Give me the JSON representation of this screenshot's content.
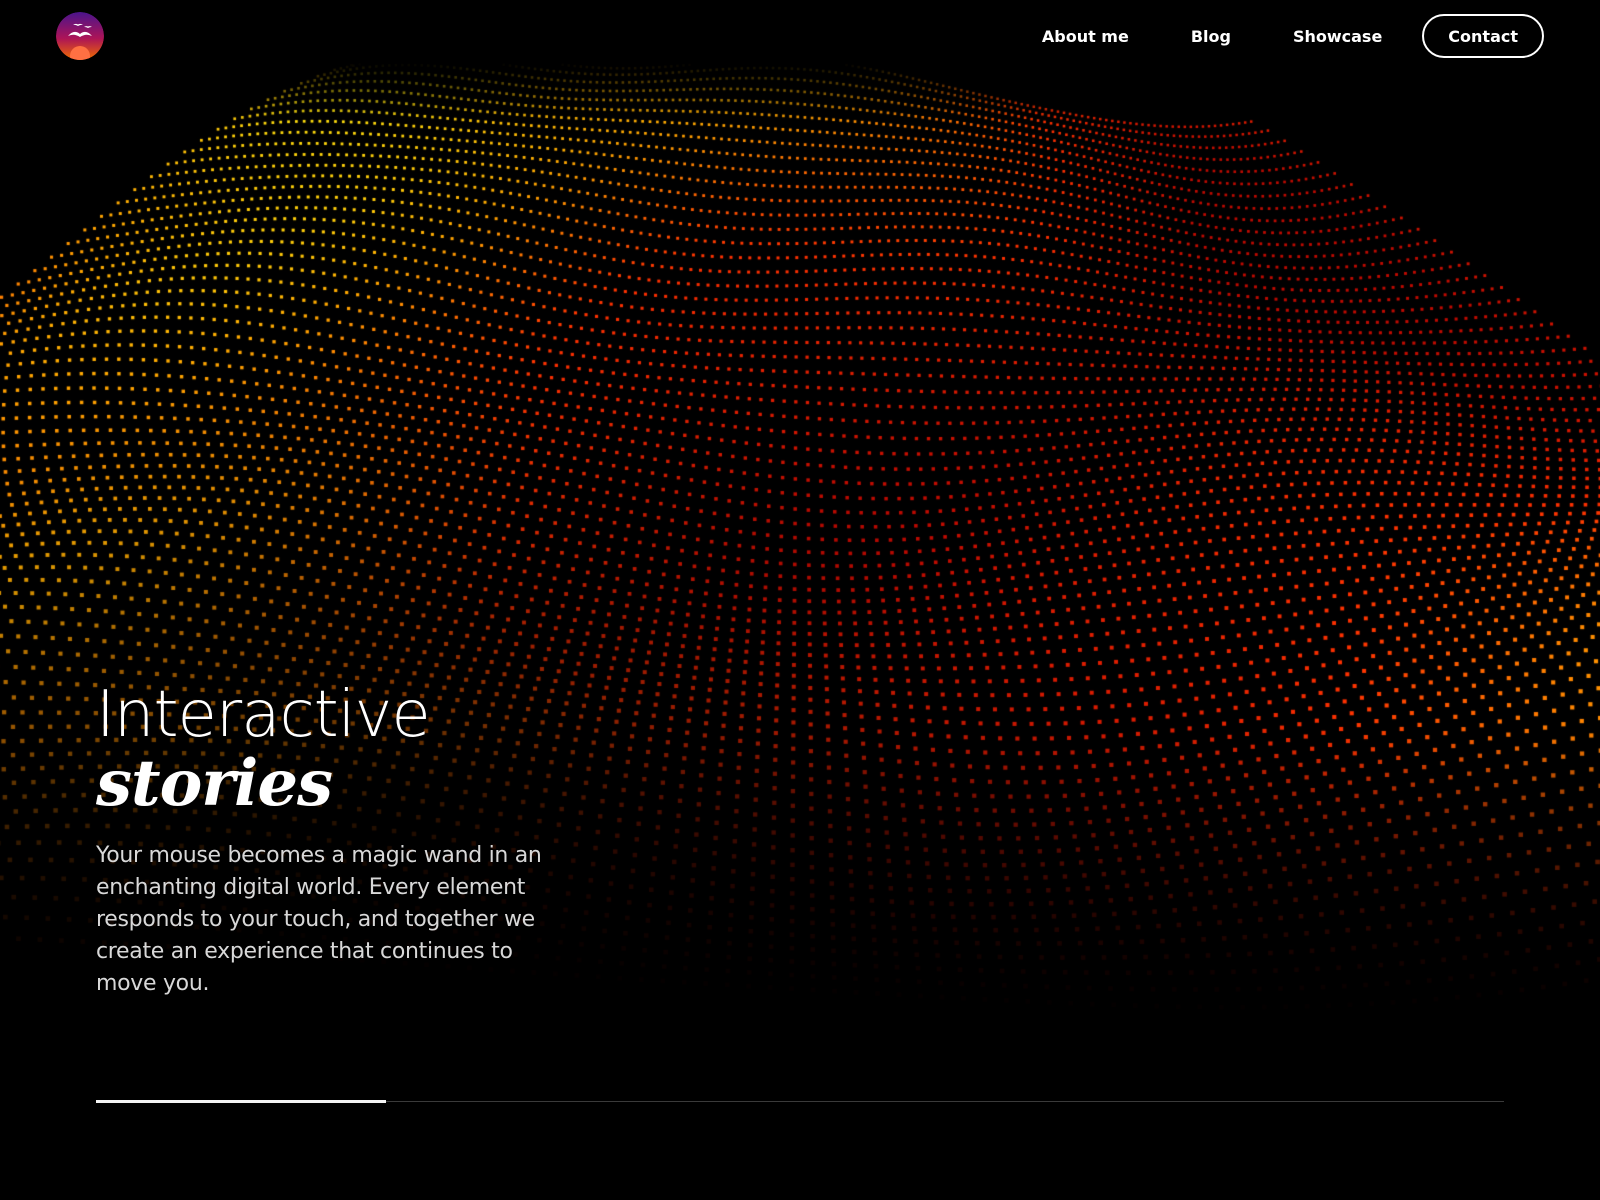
{
  "nav": {
    "items": [
      {
        "label": "About me"
      },
      {
        "label": "Blog"
      },
      {
        "label": "Showcase"
      }
    ],
    "contact_label": "Contact"
  },
  "logo": {
    "icon": "seagulls-sunset-icon",
    "colors": [
      "#5b1b7a",
      "#c2185b",
      "#f57c00"
    ]
  },
  "hero": {
    "title_line1": "Interactive",
    "title_line2": "stories",
    "description": "Your mouse becomes a magic wand in an enchanting digital world. Every element responds to your touch, and together we create an experience that continues to move you."
  },
  "slider": {
    "progress": 0.206
  },
  "theme": {
    "background": "#000000",
    "wave_colors": [
      "#ffea00",
      "#ff9800",
      "#ff3d00",
      "#d50000"
    ]
  }
}
